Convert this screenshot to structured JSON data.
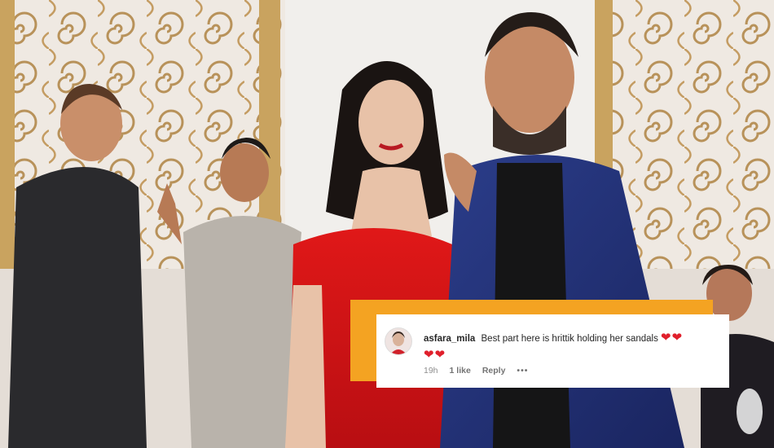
{
  "comment": {
    "username": "asfara_mila",
    "text": "Best part here is hrittik holding her sandals",
    "hearts_line1": "❤❤",
    "hearts_line2": "❤❤",
    "time": "19h",
    "likes": "1 like",
    "reply": "Reply",
    "more": "•••"
  },
  "colors": {
    "accent_orange": "#f4a322",
    "heart_red": "#e0202c"
  },
  "icons": [
    "heart-icon",
    "more-options-icon"
  ]
}
